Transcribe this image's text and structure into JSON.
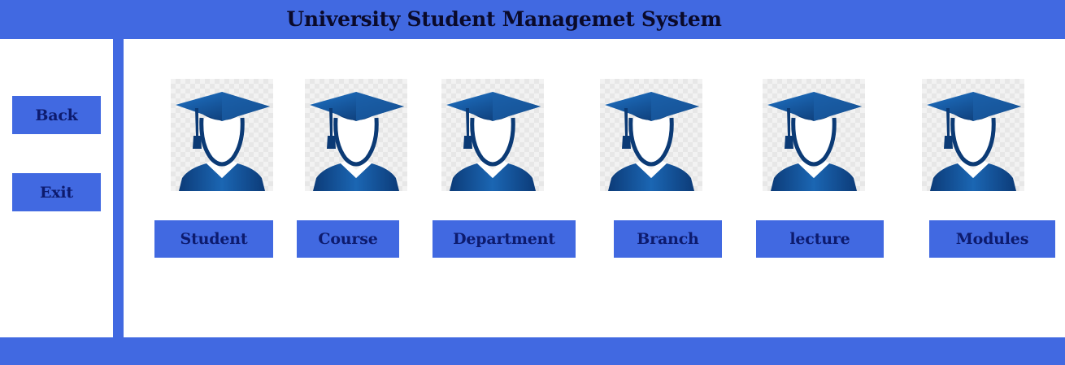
{
  "header": {
    "title": "University Student Managemet System"
  },
  "sidebar": {
    "back_label": "Back",
    "exit_label": "Exit"
  },
  "modules": [
    {
      "label": "Student",
      "icon": "graduate-icon"
    },
    {
      "label": "Course",
      "icon": "graduate-icon"
    },
    {
      "label": "Department",
      "icon": "graduate-icon"
    },
    {
      "label": "Branch",
      "icon": "graduate-icon"
    },
    {
      "label": "lecture",
      "icon": "graduate-icon"
    },
    {
      "label": "Modules",
      "icon": "graduate-icon"
    }
  ],
  "colors": {
    "accent": "#4169E1",
    "button_text": "#0d1b6e",
    "icon_dark": "#0b3a75",
    "icon_light": "#1f6fbf"
  }
}
